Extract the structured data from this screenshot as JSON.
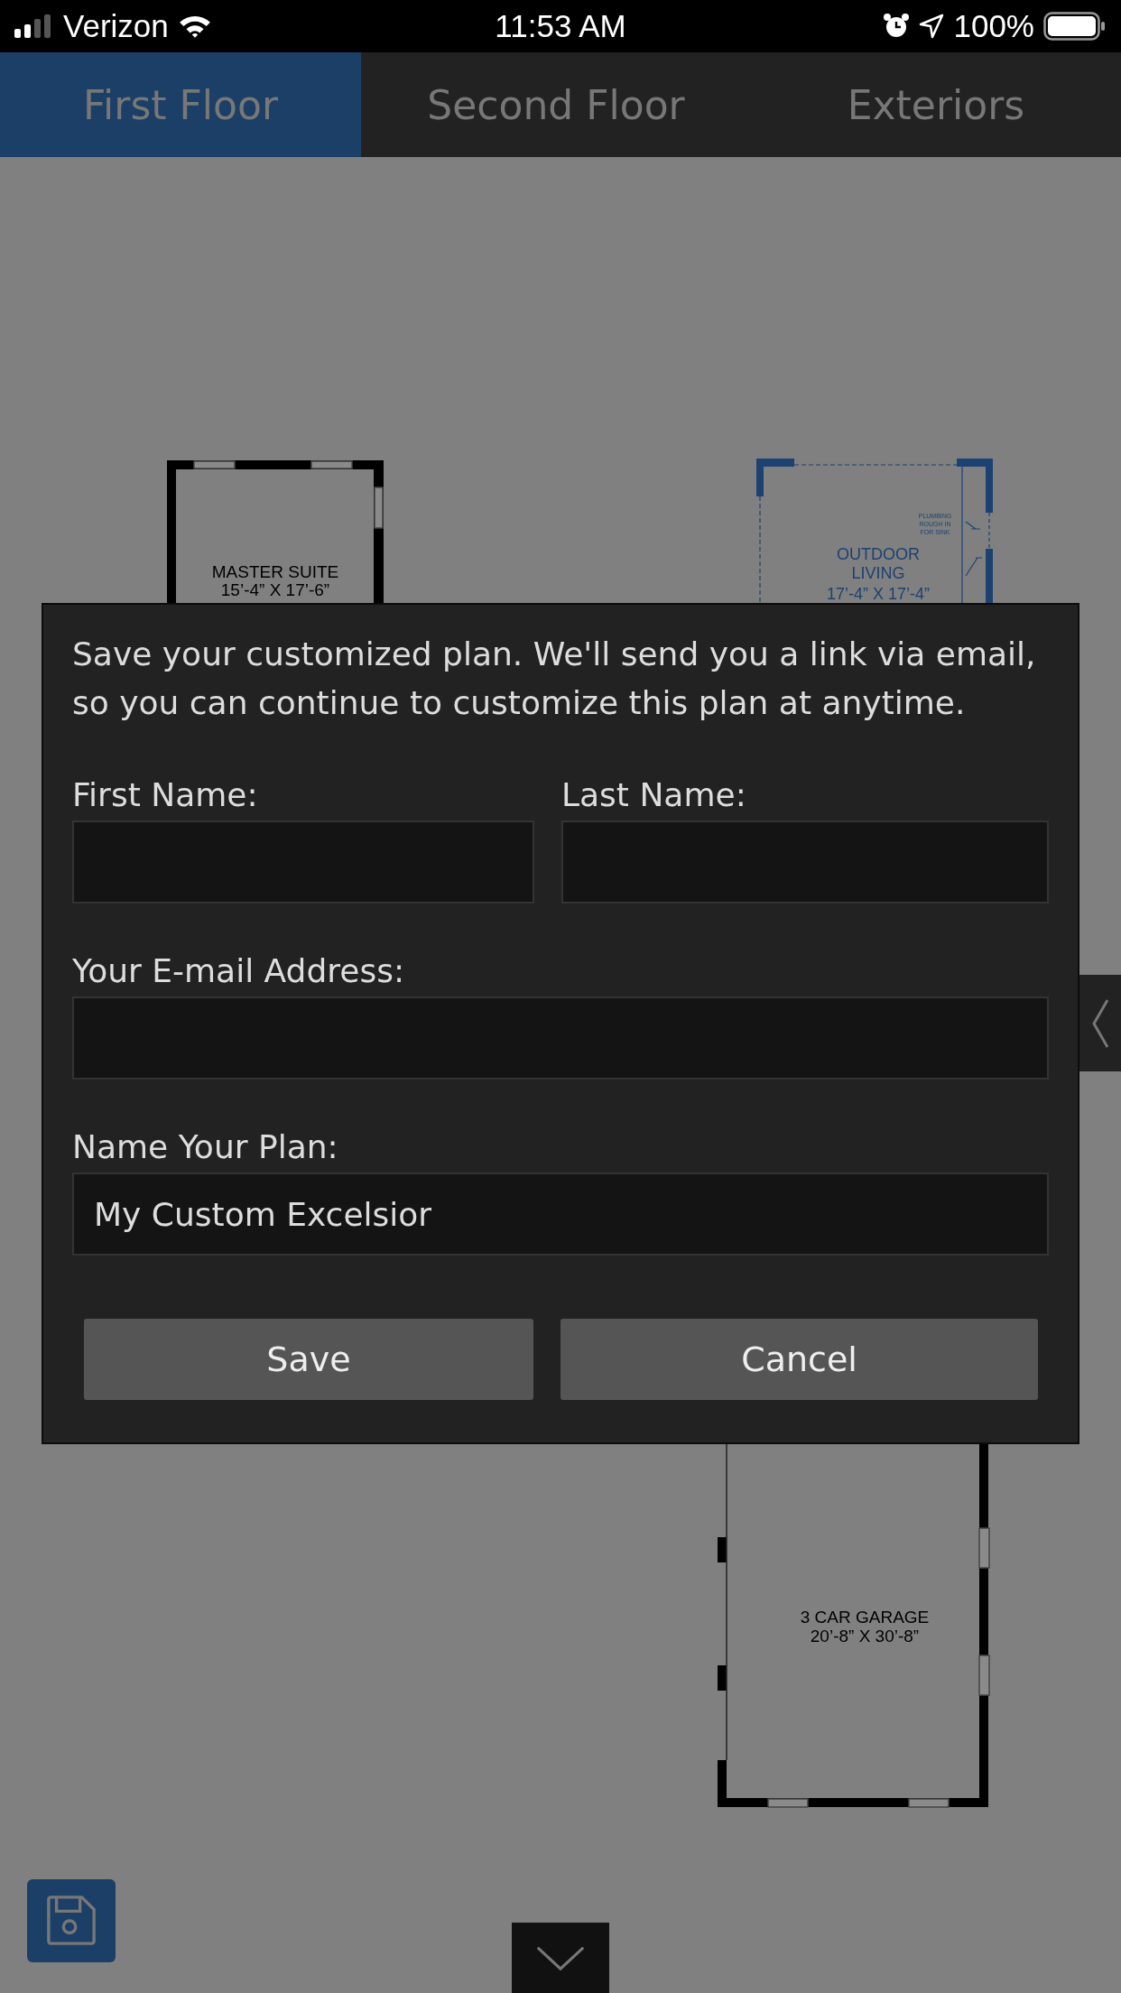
{
  "status_bar": {
    "carrier": "Verizon",
    "time": "11:53 AM",
    "battery": "100%"
  },
  "tabs": [
    {
      "label": "First Floor",
      "selected": true
    },
    {
      "label": "Second Floor",
      "selected": false
    },
    {
      "label": "Exteriors",
      "selected": false
    }
  ],
  "floor_plan": {
    "rooms": [
      {
        "name": "MASTER SUITE",
        "size": "15’-4” X 17’-6”",
        "color": "#000000"
      },
      {
        "name": "OUTDOOR LIVING",
        "size": "17’-4” X 17’-4”",
        "note": "PLUMBING ROUGH IN FOR SINK",
        "color": "#1d4170"
      },
      {
        "name": "3 CAR GARAGE",
        "size": "20’-8” X 30’-8”",
        "color": "#000000"
      }
    ]
  },
  "dialog": {
    "message": "Save your customized plan. We'll send you a link via email, so you can continue to customize this plan at anytime.",
    "fields": [
      {
        "label": "First Name:"
      },
      {
        "label": "Last Name:"
      },
      {
        "label": "Your E-mail Address:"
      },
      {
        "label": "Name Your Plan:",
        "value": "My Custom Excelsior"
      }
    ],
    "buttons": [
      "Save",
      "Cancel"
    ]
  }
}
